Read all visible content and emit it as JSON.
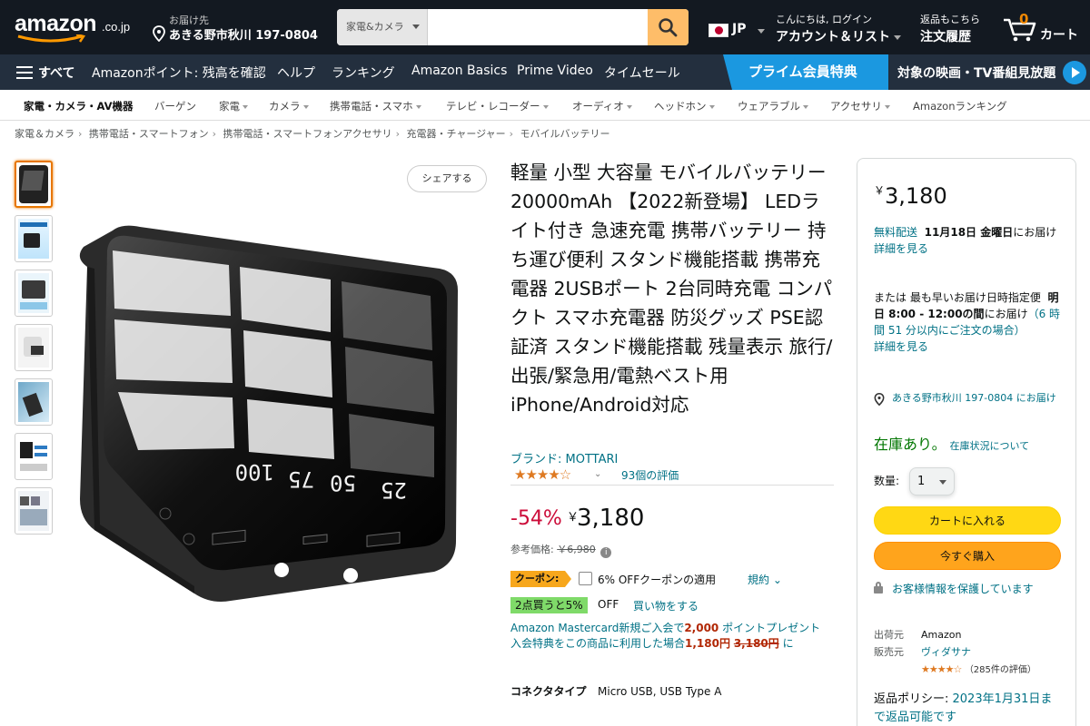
{
  "header": {
    "logo_text": "amazon",
    "logo_tld": ".co.jp",
    "deliver_label": "お届け先",
    "deliver_address": "あきる野市秋川 197-0804",
    "search_category": "家電&カメラ",
    "search_value": "",
    "language": "JP",
    "account_greeting": "こんにちは, ログイン",
    "account_label": "アカウント＆リスト",
    "returns_label": "返品もこちら",
    "orders_label": "注文履歴",
    "cart_count": "0",
    "cart_label": "カート"
  },
  "subnav": {
    "all_label": "すべて",
    "items": [
      "Amazonポイント: 残高を確認",
      "ヘルプ",
      "ランキング",
      "Amazon Basics",
      "Prime Video",
      "タイムセール"
    ],
    "prime_label": "プライム会員特典",
    "prime_promo": "対象の映画・TV番組見放題"
  },
  "category_bar": {
    "main": "家電・カメラ・AV機器",
    "items": [
      "バーゲン",
      "家電",
      "カメラ",
      "携帯電話・スマホ",
      "テレビ・レコーダー",
      "オーディオ",
      "ヘッドホン",
      "ウェアラブル",
      "アクセサリ",
      "Amazonランキング"
    ]
  },
  "breadcrumb": [
    "家電＆カメラ",
    "携帯電話・スマートフォン",
    "携帯電話・スマートフォンアクセサリ",
    "充電器・チャージャー",
    "モバイルバッテリー"
  ],
  "gallery": {
    "share_label": "シェアする",
    "display_readout": [
      "25",
      "50",
      "75",
      "100"
    ],
    "thumbnail_count": 7
  },
  "product": {
    "title": "軽量 小型 大容量 モバイルバッテリー 20000mAh 【2022新登場】 LEDライト付き 急速充電 携帯バッテリー 持ち運び便利 スタンド機能搭載 携帯充電器 2USBポート 2台同時充電 コンパクト スマホ充電器 防災グッズ PSE認証済 スタンド機能搭載 残量表示 旅行/出張/緊急用/電熱ベスト用 iPhone/Android対応",
    "brand": "ブランド: MOTTARI",
    "rating_stars": 4.0,
    "rating_stars_text": "★★★★☆",
    "rating_count": "93個の評価",
    "discount": "-54%",
    "currency": "￥",
    "price": "3,180",
    "ref_label": "参考価格: ",
    "ref_price": "￥6,980",
    "coupon_tag": "クーポン:",
    "coupon_text": "6% OFFクーポンの適用",
    "coupon_terms": "規約",
    "bundle_badge": "2点買うと5%",
    "bundle_off": "OFF",
    "bundle_shop": "買い物をする",
    "mc_line1": "Amazon Mastercard新規ご入会で",
    "mc_points": "2,000",
    "mc_line1b": " ポイントプレゼント",
    "mc_line2": "入会特典をこの商品に利用した場合",
    "mc_new_price": "1,180円",
    "mc_old_price": "3,180円",
    "mc_line2b": " に",
    "spec_key": "コネクタタイプ",
    "spec_value": "Micro USB, USB Type A"
  },
  "buybox": {
    "currency": "￥",
    "price": "3,180",
    "free_delivery": "無料配送",
    "delivery_date": "11月18日 金曜日",
    "delivery_suffix": "にお届け",
    "details_link": "詳細を見る",
    "fastest_prefix": "または 最も早いお届け日時指定便",
    "fastest_window": "明日 8:00 - 12:00の間",
    "fastest_suffix": "にお届け",
    "fastest_note": "（6 時間 51 分以内にご注文の場合）",
    "details_link2": "詳細を見る",
    "address_line": "あきる野市秋川 197-0804 にお届け",
    "in_stock": "在庫あり。",
    "stock_link": "在庫状況について",
    "qty_label": "数量:",
    "qty_value": "1",
    "add_to_cart": "カートに入れる",
    "buy_now": "今すぐ購入",
    "secure": "お客様情報を保護しています",
    "ships_from_label": "出荷元",
    "ships_from": "Amazon",
    "sold_by_label": "販売元",
    "sold_by": "ヴィダサナ",
    "seller_stars": "★★★★☆",
    "seller_ratings": "（285件の評価）",
    "return_label": "返品ポリシー: ",
    "return_date": "2023年1月31日まで返品可能です"
  },
  "colors": {
    "nav_dark": "#131921",
    "nav_secondary": "#232f3e",
    "prime_blue": "#1b98e0",
    "search_button": "#febd69",
    "cart_button": "#ffd814",
    "buy_button": "#ffa41c",
    "link": "#007185",
    "discount_red": "#cc0c39",
    "star": "#de7921",
    "in_stock": "#007600"
  }
}
